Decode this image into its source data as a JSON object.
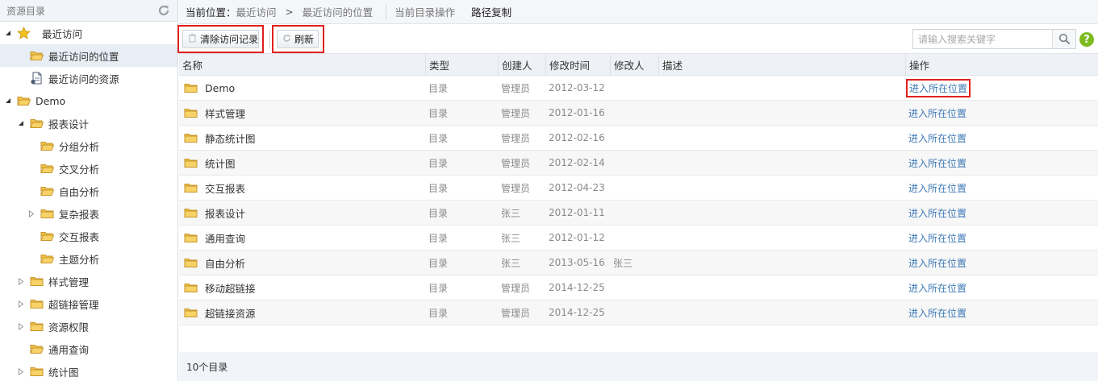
{
  "sidebar": {
    "title": "资源目录",
    "refresh_icon": "refresh-icon",
    "items": [
      {
        "label": "最近访问",
        "indent": 0,
        "arrow": "expanded",
        "icon": "star-icon"
      },
      {
        "label": "最近访问的位置",
        "indent": 1,
        "arrow": "none",
        "icon": "folder-open-icon",
        "selected": true
      },
      {
        "label": "最近访问的资源",
        "indent": 1,
        "arrow": "none",
        "icon": "document-icon"
      },
      {
        "label": "Demo",
        "indent": 0,
        "arrow": "expanded",
        "icon": "folder-open-icon"
      },
      {
        "label": "报表设计",
        "indent": 1,
        "arrow": "expanded",
        "icon": "folder-open-icon"
      },
      {
        "label": "分组分析",
        "indent": 2,
        "arrow": "none",
        "icon": "folder-open-icon"
      },
      {
        "label": "交叉分析",
        "indent": 2,
        "arrow": "none",
        "icon": "folder-open-icon"
      },
      {
        "label": "自由分析",
        "indent": 2,
        "arrow": "none",
        "icon": "folder-open-icon"
      },
      {
        "label": "复杂报表",
        "indent": 2,
        "arrow": "collapsed",
        "icon": "folder-icon"
      },
      {
        "label": "交互报表",
        "indent": 2,
        "arrow": "none",
        "icon": "folder-open-icon"
      },
      {
        "label": "主题分析",
        "indent": 2,
        "arrow": "none",
        "icon": "folder-open-icon"
      },
      {
        "label": "样式管理",
        "indent": 1,
        "arrow": "collapsed",
        "icon": "folder-icon"
      },
      {
        "label": "超链接管理",
        "indent": 1,
        "arrow": "collapsed",
        "icon": "folder-icon"
      },
      {
        "label": "资源权限",
        "indent": 1,
        "arrow": "collapsed",
        "icon": "folder-icon"
      },
      {
        "label": "通用查询",
        "indent": 1,
        "arrow": "none",
        "icon": "folder-open-icon"
      },
      {
        "label": "统计图",
        "indent": 1,
        "arrow": "collapsed",
        "icon": "folder-icon"
      }
    ]
  },
  "topbar": {
    "location_prefix": "当前位置：",
    "crumb1": "最近访问",
    "separator": ">",
    "crumb2": "最近访问的位置",
    "current_dir_ops": "当前目录操作",
    "copy_path": "路径复制"
  },
  "toolbar": {
    "clear_label": "清除访问记录",
    "clear_icon": "trash-icon",
    "refresh_label": "刷新",
    "refresh_icon": "refresh-icon",
    "search_placeholder": "请输入搜索关键字",
    "search_icon": "search-icon",
    "help_label": "?",
    "help_icon": "help-icon"
  },
  "table": {
    "columns": [
      "名称",
      "类型",
      "创建人",
      "修改时间",
      "修改人",
      "描述",
      "操作"
    ],
    "rows": [
      {
        "name": "Demo",
        "type": "目录",
        "creator": "管理员",
        "modified": "2012-03-12",
        "modifier": "",
        "desc": "",
        "action": "进入所在位置"
      },
      {
        "name": "样式管理",
        "type": "目录",
        "creator": "管理员",
        "modified": "2012-01-16",
        "modifier": "",
        "desc": "",
        "action": "进入所在位置"
      },
      {
        "name": "静态统计图",
        "type": "目录",
        "creator": "管理员",
        "modified": "2012-02-16",
        "modifier": "",
        "desc": "",
        "action": "进入所在位置"
      },
      {
        "name": "统计图",
        "type": "目录",
        "creator": "管理员",
        "modified": "2012-02-14",
        "modifier": "",
        "desc": "",
        "action": "进入所在位置"
      },
      {
        "name": "交互报表",
        "type": "目录",
        "creator": "管理员",
        "modified": "2012-04-23",
        "modifier": "",
        "desc": "",
        "action": "进入所在位置"
      },
      {
        "name": "报表设计",
        "type": "目录",
        "creator": "张三",
        "modified": "2012-01-11",
        "modifier": "",
        "desc": "",
        "action": "进入所在位置"
      },
      {
        "name": "通用查询",
        "type": "目录",
        "creator": "张三",
        "modified": "2012-01-12",
        "modifier": "",
        "desc": "",
        "action": "进入所在位置"
      },
      {
        "name": "自由分析",
        "type": "目录",
        "creator": "张三",
        "modified": "2013-05-16",
        "modifier": "张三",
        "desc": "",
        "action": "进入所在位置"
      },
      {
        "name": "移动超链接",
        "type": "目录",
        "creator": "管理员",
        "modified": "2014-12-25",
        "modifier": "",
        "desc": "",
        "action": "进入所在位置"
      },
      {
        "name": "超链接资源",
        "type": "目录",
        "creator": "管理员",
        "modified": "2014-12-25",
        "modifier": "",
        "desc": "",
        "action": "进入所在位置"
      }
    ]
  },
  "footer": {
    "count_text": "10个目录"
  },
  "colors": {
    "link": "#3d78b6",
    "highlight_box": "#e0201e",
    "help_green": "#7dbb21",
    "folder_yellow": "#f2c24a"
  }
}
